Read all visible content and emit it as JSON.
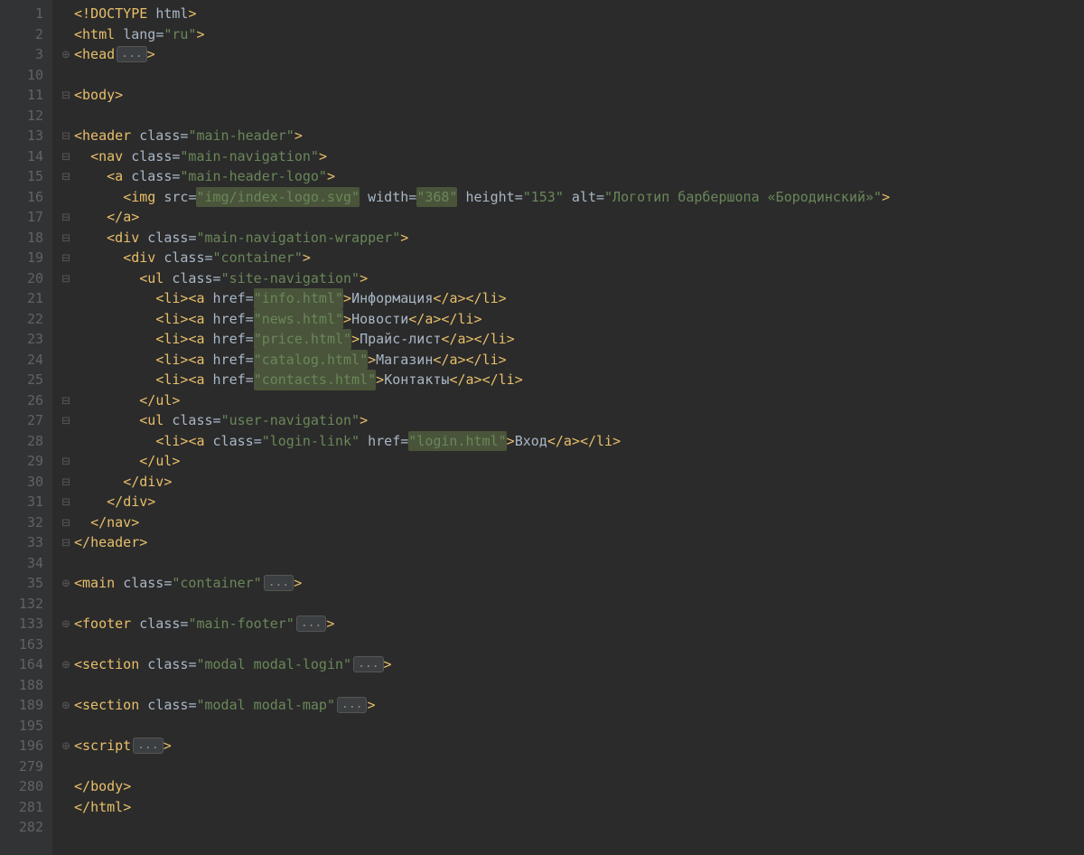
{
  "gutter": [
    "1",
    "2",
    "3",
    "10",
    "11",
    "12",
    "13",
    "14",
    "15",
    "16",
    "17",
    "18",
    "19",
    "20",
    "21",
    "22",
    "23",
    "24",
    "25",
    "26",
    "27",
    "28",
    "29",
    "30",
    "31",
    "32",
    "33",
    "34",
    "35",
    "132",
    "133",
    "163",
    "164",
    "188",
    "189",
    "195",
    "196",
    "279",
    "280",
    "281",
    "282"
  ],
  "fold": [
    "",
    "",
    "⊕",
    "",
    "⊟",
    "",
    "⊟",
    "⊟",
    "⊟",
    "",
    "⊟",
    "⊟",
    "⊟",
    "⊟",
    "",
    "",
    "",
    "",
    "",
    "⊟",
    "⊟",
    "",
    "⊟",
    "⊟",
    "⊟",
    "⊟",
    "⊟",
    "",
    "⊕",
    "",
    "⊕",
    "",
    "⊕",
    "",
    "⊕",
    "",
    "⊕",
    "",
    "",
    "",
    ""
  ],
  "code": {
    "l1": {
      "pre": "<!",
      "kw": "DOCTYPE",
      "sp": " ",
      "attr": "html",
      "post": ">"
    },
    "l2": {
      "open": "<",
      "tag": "html",
      "sp": " ",
      "attr": "lang",
      "eq": "=",
      "val": "\"ru\"",
      "close": ">"
    },
    "l3": {
      "open": "<",
      "tag": "head",
      "fold": "...",
      "close": ">"
    },
    "l5": {
      "open": "<",
      "tag": "body",
      "close": ">"
    },
    "l7": {
      "open": "<",
      "tag": "header",
      "sp": " ",
      "attr": "class",
      "eq": "=",
      "val": "\"main-header\"",
      "close": ">"
    },
    "l8": {
      "open": "<",
      "tag": "nav",
      "sp": " ",
      "attr": "class",
      "eq": "=",
      "val": "\"main-navigation\"",
      "close": ">"
    },
    "l9": {
      "open": "<",
      "tag": "a",
      "sp": " ",
      "attr": "class",
      "eq": "=",
      "val": "\"main-header-logo\"",
      "close": ">"
    },
    "l10": {
      "open": "<",
      "tag": "img",
      "sp": " ",
      "a1": "src",
      "v1": "\"img/index-logo.svg\"",
      "a2": "width",
      "v2": "\"368\"",
      "a3": "height",
      "v3": "\"153\"",
      "a4": "alt",
      "v4": "\"Логотип барбершопа «Бородинский»\"",
      "close": ">"
    },
    "l11": {
      "open": "</",
      "tag": "a",
      "close": ">"
    },
    "l12": {
      "open": "<",
      "tag": "div",
      "sp": " ",
      "attr": "class",
      "eq": "=",
      "val": "\"main-navigation-wrapper\"",
      "close": ">"
    },
    "l13": {
      "open": "<",
      "tag": "div",
      "sp": " ",
      "attr": "class",
      "eq": "=",
      "val": "\"container\"",
      "close": ">"
    },
    "l14": {
      "open": "<",
      "tag": "ul",
      "sp": " ",
      "attr": "class",
      "eq": "=",
      "val": "\"site-navigation\"",
      "close": ">"
    },
    "l15": {
      "href": "\"info.html\"",
      "text": "Информация"
    },
    "l16": {
      "href": "\"news.html\"",
      "text": "Новости"
    },
    "l17": {
      "href": "\"price.html\"",
      "text": "Прайс-лист"
    },
    "l18": {
      "href": "\"catalog.html\"",
      "text": "Магазин"
    },
    "l19": {
      "href": "\"contacts.html\"",
      "text": "Контакты"
    },
    "l20": {
      "open": "</",
      "tag": "ul",
      "close": ">"
    },
    "l21": {
      "open": "<",
      "tag": "ul",
      "sp": " ",
      "attr": "class",
      "eq": "=",
      "val": "\"user-navigation\"",
      "close": ">"
    },
    "l22": {
      "cls": "\"login-link\"",
      "href": "\"login.html\"",
      "text": "Вход"
    },
    "l23": {
      "open": "</",
      "tag": "ul",
      "close": ">"
    },
    "l24": {
      "open": "</",
      "tag": "div",
      "close": ">"
    },
    "l25": {
      "open": "</",
      "tag": "div",
      "close": ">"
    },
    "l26": {
      "open": "</",
      "tag": "nav",
      "close": ">"
    },
    "l27": {
      "open": "</",
      "tag": "header",
      "close": ">"
    },
    "l29": {
      "open": "<",
      "tag": "main",
      "sp": " ",
      "attr": "class",
      "eq": "=",
      "val": "\"container\"",
      "fold": "...",
      "close": ">"
    },
    "l31": {
      "open": "<",
      "tag": "footer",
      "sp": " ",
      "attr": "class",
      "eq": "=",
      "val": "\"main-footer\"",
      "fold": "...",
      "close": ">"
    },
    "l33": {
      "open": "<",
      "tag": "section",
      "sp": " ",
      "attr": "class",
      "eq": "=",
      "val": "\"modal modal-login\"",
      "fold": "...",
      "close": ">"
    },
    "l35": {
      "open": "<",
      "tag": "section",
      "sp": " ",
      "attr": "class",
      "eq": "=",
      "val": "\"modal modal-map\"",
      "fold": "...",
      "close": ">"
    },
    "l37": {
      "open": "<",
      "tag": "script",
      "fold": "...",
      "close": ">"
    },
    "l39": {
      "open": "</",
      "tag": "body",
      "close": ">"
    },
    "l40": {
      "open": "</",
      "tag": "html",
      "close": ">"
    }
  },
  "punct": {
    "lt": "<",
    "gt": ">",
    "lts": "</",
    "eq": "="
  },
  "li": {
    "liOpen": "li",
    "aOpen": "a",
    "href": "href",
    "class": "class"
  }
}
